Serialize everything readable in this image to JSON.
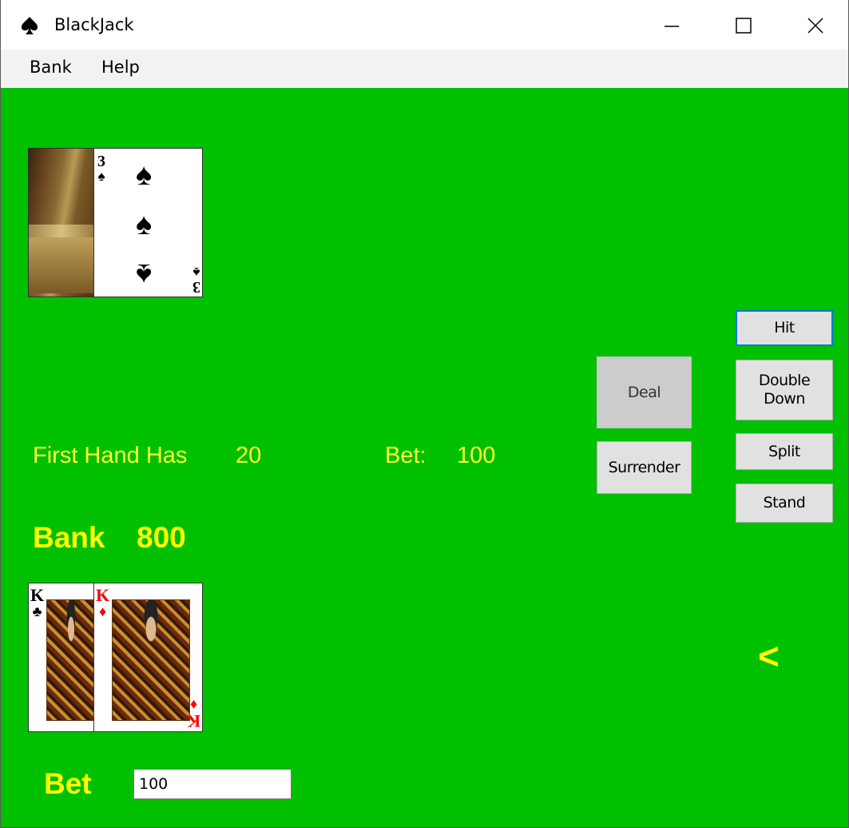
{
  "window": {
    "title": "BlackJack",
    "app_icon": "spade-icon"
  },
  "controls": {
    "minimize": "minimize-icon",
    "maximize": "maximize-icon",
    "close": "close-icon"
  },
  "menu": {
    "items": [
      "Bank",
      "Help"
    ]
  },
  "dealer": {
    "cards": [
      {
        "face": "down"
      },
      {
        "rank": "3",
        "suit": "♠",
        "color": "#000000"
      }
    ]
  },
  "player": {
    "cards": [
      {
        "rank": "K",
        "suit": "♣",
        "color": "#000000"
      },
      {
        "rank": "K",
        "suit": "♦",
        "color": "#ff0000"
      }
    ]
  },
  "status": {
    "hand_label": "First Hand Has",
    "hand_value": "20",
    "bet_label": "Bet:",
    "bet_value": "100"
  },
  "bank": {
    "label": "Bank",
    "value": "800"
  },
  "buttons": {
    "deal": "Deal",
    "surrender": "Surrender",
    "hit": "Hit",
    "double_down": "Double Down",
    "split": "Split",
    "stand": "Stand"
  },
  "indicator": "<",
  "bet": {
    "label": "Bet",
    "value": "100"
  },
  "colors": {
    "table": "#00c000",
    "text_yellow": "#ffff33",
    "focus_blue": "#0078d7"
  }
}
